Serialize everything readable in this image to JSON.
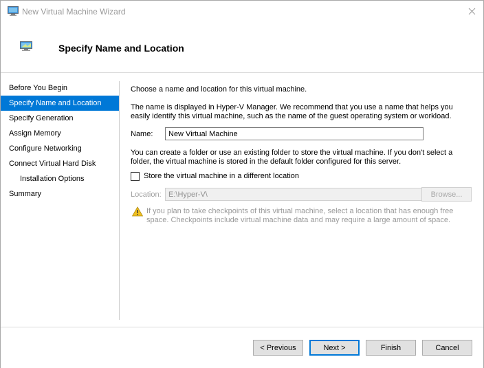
{
  "window": {
    "title": "New Virtual Machine Wizard"
  },
  "header": {
    "title": "Specify Name and Location"
  },
  "nav": {
    "items": [
      {
        "label": "Before You Begin"
      },
      {
        "label": "Specify Name and Location"
      },
      {
        "label": "Specify Generation"
      },
      {
        "label": "Assign Memory"
      },
      {
        "label": "Configure Networking"
      },
      {
        "label": "Connect Virtual Hard Disk"
      },
      {
        "label": "Installation Options"
      },
      {
        "label": "Summary"
      }
    ]
  },
  "content": {
    "intro": "Choose a name and location for this virtual machine.",
    "name_description": "The name is displayed in Hyper-V Manager. We recommend that you use a name that helps you easily identify this virtual machine, such as the name of the guest operating system or workload.",
    "name_label": "Name:",
    "name_value": "New Virtual Machine",
    "folder_description": "You can create a folder or use an existing folder to store the virtual machine. If you don't select a folder, the virtual machine is stored in the default folder configured for this server.",
    "store_checkbox_label": "Store the virtual machine in a different location",
    "location_label": "Location:",
    "location_value": "E:\\Hyper-V\\",
    "browse_label": "Browse...",
    "warning": "If you plan to take checkpoints of this virtual machine, select a location that has enough free space. Checkpoints include virtual machine data and may require a large amount of space."
  },
  "footer": {
    "previous_label": "< Previous",
    "next_label": "Next >",
    "finish_label": "Finish",
    "cancel_label": "Cancel"
  },
  "colors": {
    "accent": "#0078d7",
    "warning": "#f0c020"
  }
}
